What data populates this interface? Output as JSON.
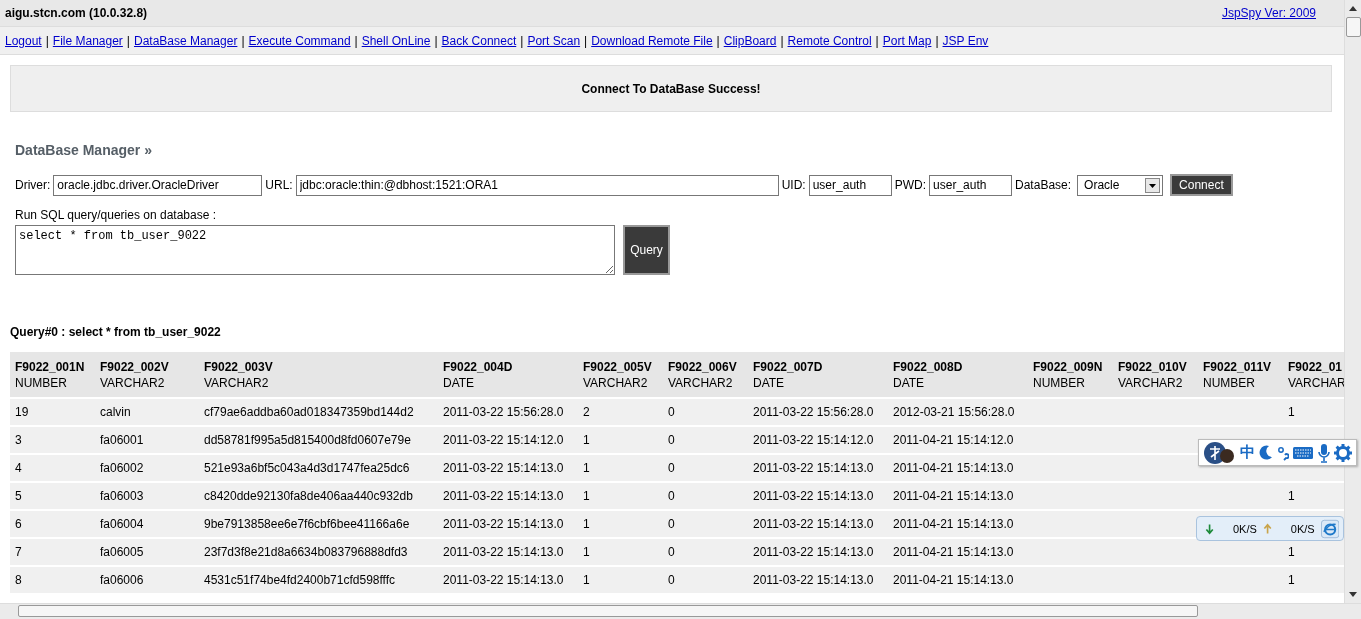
{
  "header": {
    "host": "aigu.stcn.com (10.0.32.8)",
    "version_link": "JspSpy Ver: 2009"
  },
  "nav": [
    {
      "kind": "link",
      "text": "Logout"
    },
    {
      "kind": "separator",
      "text": "|"
    },
    {
      "kind": "link",
      "text": "File Manager"
    },
    {
      "kind": "separator",
      "text": "|"
    },
    {
      "kind": "link",
      "text": "DataBase Manager"
    },
    {
      "kind": "separator",
      "text": "|"
    },
    {
      "kind": "link",
      "text": "Execute Command"
    },
    {
      "kind": "separator",
      "text": "|"
    },
    {
      "kind": "link",
      "text": "Shell OnLine"
    },
    {
      "kind": "separator",
      "text": "|"
    },
    {
      "kind": "link",
      "text": "Back Connect"
    },
    {
      "kind": "separator",
      "text": "|"
    },
    {
      "kind": "link",
      "text": "Port Scan"
    },
    {
      "kind": "separator",
      "text": "|"
    },
    {
      "kind": "link",
      "text": "Download Remote File"
    },
    {
      "kind": "separator",
      "text": "|"
    },
    {
      "kind": "link",
      "text": "ClipBoard"
    },
    {
      "kind": "separator",
      "text": "|"
    },
    {
      "kind": "link",
      "text": "Remote Control"
    },
    {
      "kind": "separator",
      "text": "|"
    },
    {
      "kind": "link",
      "text": "Port Map"
    },
    {
      "kind": "separator",
      "text": "|"
    },
    {
      "kind": "link",
      "text": "JSP Env"
    }
  ],
  "message": "Connect To DataBase Success!",
  "section_title": "DataBase Manager »",
  "connection": {
    "driver_label": "Driver:",
    "driver": "oracle.jdbc.driver.OracleDriver",
    "url_label": "URL:",
    "url": "jdbc:oracle:thin:@dbhost:1521:ORA1",
    "uid_label": "UID:",
    "uid": "user_auth",
    "pwd_label": "PWD:",
    "pwd": "user_auth",
    "database_label": "DataBase:",
    "database": "Oracle",
    "connect_button": "Connect"
  },
  "sql": {
    "label": "Run SQL query/queries on database :",
    "query": "select * from tb_user_9022",
    "query_button": "Query"
  },
  "result_title": "Query#0 : select * from tb_user_9022",
  "table": {
    "columns": [
      {
        "name": "F9022_001N",
        "type": "NUMBER"
      },
      {
        "name": "F9022_002V",
        "type": "VARCHAR2"
      },
      {
        "name": "F9022_003V",
        "type": "VARCHAR2"
      },
      {
        "name": "F9022_004D",
        "type": "DATE"
      },
      {
        "name": "F9022_005V",
        "type": "VARCHAR2"
      },
      {
        "name": "F9022_006V",
        "type": "VARCHAR2"
      },
      {
        "name": "F9022_007D",
        "type": "DATE"
      },
      {
        "name": "F9022_008D",
        "type": "DATE"
      },
      {
        "name": "F9022_009N",
        "type": "NUMBER"
      },
      {
        "name": "F9022_010V",
        "type": "VARCHAR2"
      },
      {
        "name": "F9022_011V",
        "type": "NUMBER"
      },
      {
        "name": "F9022_01",
        "type": "VARCHAR"
      }
    ],
    "rows": [
      [
        "19",
        "calvin",
        "cf79ae6addba60ad018347359bd144d2",
        "2011-03-22 15:56:28.0",
        "2",
        "0",
        "2011-03-22 15:56:28.0",
        "2012-03-21 15:56:28.0",
        null,
        null,
        null,
        "1"
      ],
      [
        "3",
        "fa06001",
        "dd58781f995a5d815400d8fd0607e79e",
        "2011-03-22 15:14:12.0",
        "1",
        "0",
        "2011-03-22 15:14:12.0",
        "2011-04-21 15:14:12.0",
        null,
        null,
        null,
        null
      ],
      [
        "4",
        "fa06002",
        "521e93a6bf5c043a4d3d1747fea25dc6",
        "2011-03-22 15:14:13.0",
        "1",
        "0",
        "2011-03-22 15:14:13.0",
        "2011-04-21 15:14:13.0",
        null,
        null,
        null,
        null
      ],
      [
        "5",
        "fa06003",
        "c8420dde92130fa8de406aa440c932db",
        "2011-03-22 15:14:13.0",
        "1",
        "0",
        "2011-03-22 15:14:13.0",
        "2011-04-21 15:14:13.0",
        null,
        null,
        null,
        "1"
      ],
      [
        "6",
        "fa06004",
        "9be7913858ee6e7f6cbf6bee41166a6e",
        "2011-03-22 15:14:13.0",
        "1",
        "0",
        "2011-03-22 15:14:13.0",
        "2011-04-21 15:14:13.0",
        null,
        null,
        null,
        null
      ],
      [
        "7",
        "fa06005",
        "23f7d3f8e21d8a6634b083796888dfd3",
        "2011-03-22 15:14:13.0",
        "1",
        "0",
        "2011-03-22 15:14:13.0",
        "2011-04-21 15:14:13.0",
        null,
        null,
        null,
        "1"
      ],
      [
        "8",
        "fa06006",
        "4531c51f74be4fd2400b71cfd598fffc",
        "2011-03-22 15:14:13.0",
        "1",
        "0",
        "2011-03-22 15:14:13.0",
        "2011-04-21 15:14:13.0",
        null,
        null,
        null,
        "1"
      ]
    ]
  },
  "ime_toolbar": {
    "mode": "中"
  },
  "speed_widget": {
    "download": "0K/S",
    "upload": "0K/S"
  }
}
